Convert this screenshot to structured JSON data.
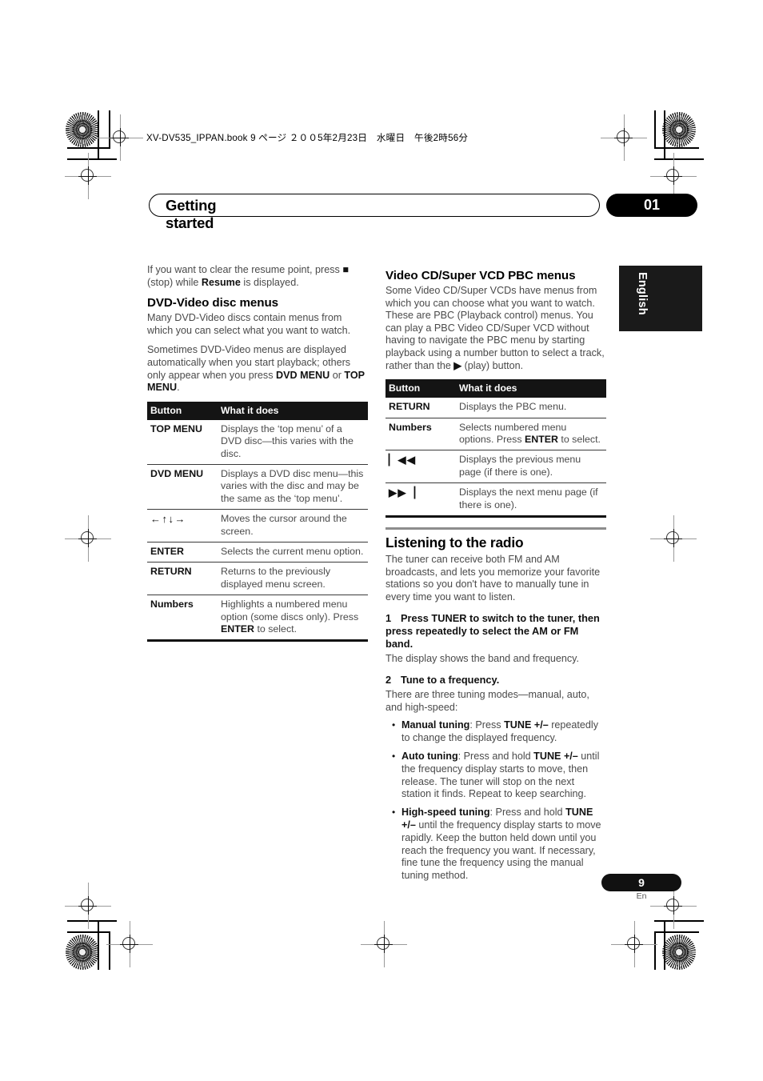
{
  "header": {
    "file_info": "XV-DV535_IPPAN.book  9 ページ  ２００5年2月23日　水曜日　午後2時56分",
    "chapter_title": "Getting started",
    "chapter_number": "01",
    "language_tab": "English"
  },
  "left_column": {
    "intro_paragraph_html": "If you want to clear the resume point, press <b>■</b> (stop) while <b>Resume</b> is displayed.",
    "heading": "DVD-Video disc menus",
    "paragraph_1": "Many DVD-Video discs contain menus from which you can select what you want to watch.",
    "paragraph_2_html": "Sometimes DVD-Video menus are displayed automatically when you start playback; others only appear when you press <b>DVD MENU</b> or <b>TOP MENU</b>.",
    "table": {
      "headers": [
        "Button",
        "What it does"
      ],
      "rows": [
        {
          "button": "TOP MENU",
          "desc_html": "Displays the &lsquo;top menu&rsquo; of a DVD disc&mdash;this varies with the disc."
        },
        {
          "button": "DVD MENU",
          "desc_html": "Displays a DVD disc menu&mdash;this varies with the disc and may be the same as the &lsquo;top menu&rsquo;."
        },
        {
          "button": "←↑↓→",
          "desc_html": "Moves the cursor around the screen."
        },
        {
          "button": "ENTER",
          "desc_html": "Selects the current menu option."
        },
        {
          "button": "RETURN",
          "desc_html": "Returns to the previously displayed menu screen."
        },
        {
          "button": "Numbers",
          "desc_html": "Highlights a numbered menu option (some discs only). Press <b>ENTER</b> to select."
        }
      ]
    }
  },
  "right_column": {
    "heading": "Video CD/Super VCD PBC menus",
    "paragraph_1_html": "Some Video CD/Super VCDs have menus from which you can choose what you want to watch. These are PBC (Playback control) menus. You can play a PBC Video CD/Super VCD without having to navigate the PBC menu by starting playback using a number button to select a track, rather than the <b>▶</b> (play) button.",
    "table": {
      "headers": [
        "Button",
        "What it does"
      ],
      "rows": [
        {
          "button": "RETURN",
          "desc_html": "Displays the PBC menu."
        },
        {
          "button": "Numbers",
          "desc_html": "Selects numbered menu options. Press <b>ENTER</b> to select."
        },
        {
          "button": "▏◀◀",
          "desc_html": "Displays the previous menu page (if there is one)."
        },
        {
          "button": "▶▶▕",
          "desc_html": "Displays the next menu page (if there is one)."
        }
      ]
    },
    "radio_section": {
      "heading": "Listening to the radio",
      "intro": "The tuner can receive both FM and AM broadcasts, and lets you memorize your favorite stations so you don't have to manually tune in every time you want to listen.",
      "steps": [
        {
          "number": "1",
          "title": "Press TUNER to switch to the tuner, then press repeatedly to select the AM or FM band.",
          "body": "The display shows the band and frequency."
        },
        {
          "number": "2",
          "title": "Tune to a frequency.",
          "body": "There are three tuning modes—manual, auto, and high-speed:"
        }
      ],
      "bullets": [
        "<b>Manual tuning</b>: Press <b>TUNE +/–</b> repeatedly to change the displayed frequency.",
        "<b>Auto tuning</b>: Press and hold <b>TUNE +/–</b> until the frequency display starts to move, then release. The tuner will stop on the next station it finds. Repeat to keep searching.",
        "<b>High-speed tuning</b>: Press and hold <b>TUNE +/–</b> until the frequency display starts to move rapidly. Keep the button held down until you reach the frequency you want. If necessary, fine tune the frequency using the manual tuning method."
      ]
    }
  },
  "footer": {
    "page_number": "9",
    "page_language": "En"
  }
}
